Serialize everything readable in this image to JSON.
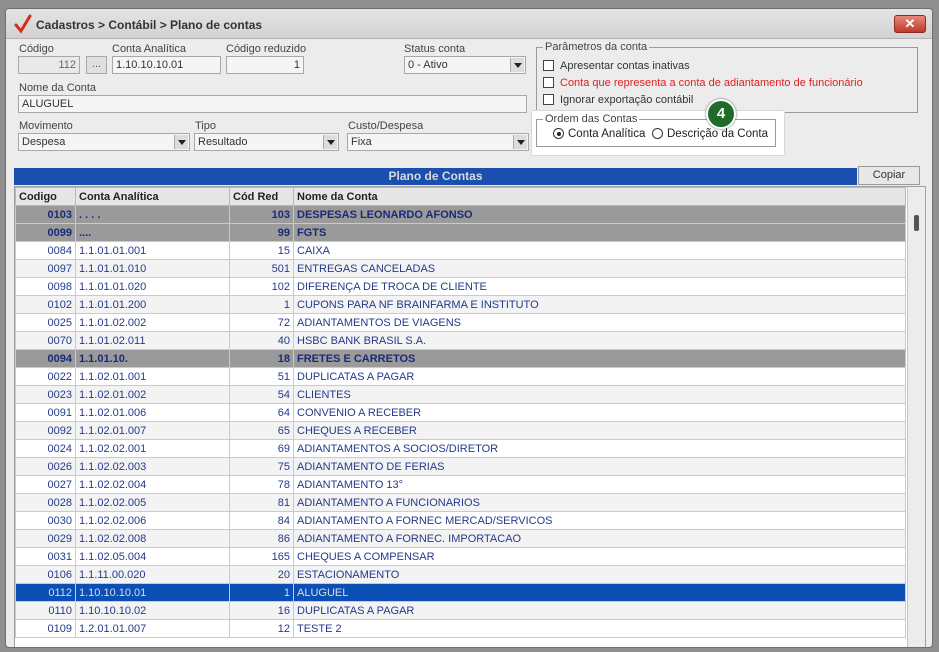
{
  "window": {
    "title": "Cadastros > Contábil > Plano de contas",
    "close_label": "✕"
  },
  "form": {
    "codigo_label": "Código",
    "codigo_value": "112",
    "conta_analitica_label": "Conta Analítica",
    "conta_analitica_value": "1.10.10.10.01",
    "codigo_reduzido_label": "Código reduzido",
    "codigo_reduzido_value": "1",
    "status_label": "Status conta",
    "status_value": "0 - Ativo",
    "nome_label": "Nome da Conta",
    "nome_value": "ALUGUEL",
    "movimento_label": "Movimento",
    "movimento_value": "Despesa",
    "tipo_label": "Tipo",
    "tipo_value": "Resultado",
    "custo_label": "Custo/Despesa",
    "custo_value": "Fixa",
    "lookup_btn": "..."
  },
  "parametros": {
    "label": "Parâmetros da conta",
    "items": [
      {
        "label": "Apresentar contas inativas",
        "checked": false,
        "color": "#333333"
      },
      {
        "label": "Conta que representa a conta de adiantamento de funcionário",
        "checked": false,
        "color": "#e02020"
      },
      {
        "label": "Ignorar exportação contábil",
        "checked": false,
        "color": "#333333"
      }
    ]
  },
  "ordem": {
    "label": "Ordem das Contas",
    "option1": "Conta Analítica",
    "option2": "Descrição da Conta",
    "selected": "Conta Analítica",
    "step_badge": "4"
  },
  "grid": {
    "title": "Plano de Contas",
    "copy_label": "Copiar",
    "columns": [
      "Codigo",
      "Conta Analítica",
      "Cód Red",
      "Nome da Conta"
    ],
    "rows": [
      {
        "codigo": "0103",
        "conta": ". . . .",
        "red": "103",
        "nome": "DESPESAS LEONARDO AFONSO",
        "type": "group"
      },
      {
        "codigo": "0099",
        "conta": "....",
        "red": "99",
        "nome": "FGTS",
        "type": "group"
      },
      {
        "codigo": "0084",
        "conta": "1.1.01.01.001",
        "red": "15",
        "nome": "CAIXA",
        "type": "normal"
      },
      {
        "codigo": "0097",
        "conta": "1.1.01.01.010",
        "red": "501",
        "nome": "ENTREGAS CANCELADAS",
        "type": "alt"
      },
      {
        "codigo": "0098",
        "conta": "1.1.01.01.020",
        "red": "102",
        "nome": "DIFERENÇA DE TROCA DE CLIENTE",
        "type": "normal"
      },
      {
        "codigo": "0102",
        "conta": "1.1.01.01.200",
        "red": "1",
        "nome": "CUPONS PARA NF BRAINFARMA E INSTITUTO",
        "type": "alt"
      },
      {
        "codigo": "0025",
        "conta": "1.1.01.02.002",
        "red": "72",
        "nome": "ADIANTAMENTOS DE VIAGENS",
        "type": "normal"
      },
      {
        "codigo": "0070",
        "conta": "1.1.01.02.011",
        "red": "40",
        "nome": "HSBC BANK BRASIL S.A.",
        "type": "alt"
      },
      {
        "codigo": "0094",
        "conta": "1.1.01.10.",
        "red": "18",
        "nome": "FRETES E CARRETOS",
        "type": "group"
      },
      {
        "codigo": "0022",
        "conta": "1.1.02.01.001",
        "red": "51",
        "nome": "DUPLICATAS A PAGAR",
        "type": "normal"
      },
      {
        "codigo": "0023",
        "conta": "1.1.02.01.002",
        "red": "54",
        "nome": "CLIENTES",
        "type": "alt"
      },
      {
        "codigo": "0091",
        "conta": "1.1.02.01.006",
        "red": "64",
        "nome": "CONVENIO A RECEBER",
        "type": "normal"
      },
      {
        "codigo": "0092",
        "conta": "1.1.02.01.007",
        "red": "65",
        "nome": "CHEQUES A RECEBER",
        "type": "alt"
      },
      {
        "codigo": "0024",
        "conta": "1.1.02.02.001",
        "red": "69",
        "nome": "ADIANTAMENTOS A SOCIOS/DIRETOR",
        "type": "normal"
      },
      {
        "codigo": "0026",
        "conta": "1.1.02.02.003",
        "red": "75",
        "nome": "ADIANTAMENTO DE FERIAS",
        "type": "alt"
      },
      {
        "codigo": "0027",
        "conta": "1.1.02.02.004",
        "red": "78",
        "nome": "ADIANTAMENTO 13°",
        "type": "normal"
      },
      {
        "codigo": "0028",
        "conta": "1.1.02.02.005",
        "red": "81",
        "nome": "ADIANTAMENTO A FUNCIONARIOS",
        "type": "alt"
      },
      {
        "codigo": "0030",
        "conta": "1.1.02.02.006",
        "red": "84",
        "nome": "ADIANTAMENTO A FORNEC MERCAD/SERVICOS",
        "type": "normal"
      },
      {
        "codigo": "0029",
        "conta": "1.1.02.02.008",
        "red": "86",
        "nome": "ADIANTAMENTO A FORNEC. IMPORTACAO",
        "type": "alt"
      },
      {
        "codigo": "0031",
        "conta": "1.1.02.05.004",
        "red": "165",
        "nome": "CHEQUES A COMPENSAR",
        "type": "normal"
      },
      {
        "codigo": "0106",
        "conta": "1.1.11.00.020",
        "red": "20",
        "nome": "ESTACIONAMENTO",
        "type": "alt"
      },
      {
        "codigo": "0112",
        "conta": "1.10.10.10.01",
        "red": "1",
        "nome": "ALUGUEL",
        "type": "selected"
      },
      {
        "codigo": "0110",
        "conta": "1.10.10.10.02",
        "red": "16",
        "nome": "DUPLICATAS A PAGAR",
        "type": "alt"
      },
      {
        "codigo": "0109",
        "conta": "1.2.01.01.007",
        "red": "12",
        "nome": "TESTE 2",
        "type": "normal"
      }
    ]
  },
  "colors": {
    "header_blue": "#1a4fb0",
    "selected_blue": "#0b4fb5",
    "group_gray": "#9a9a9a",
    "badge_green": "#1f6b2a",
    "text_blue": "#243a8c"
  }
}
